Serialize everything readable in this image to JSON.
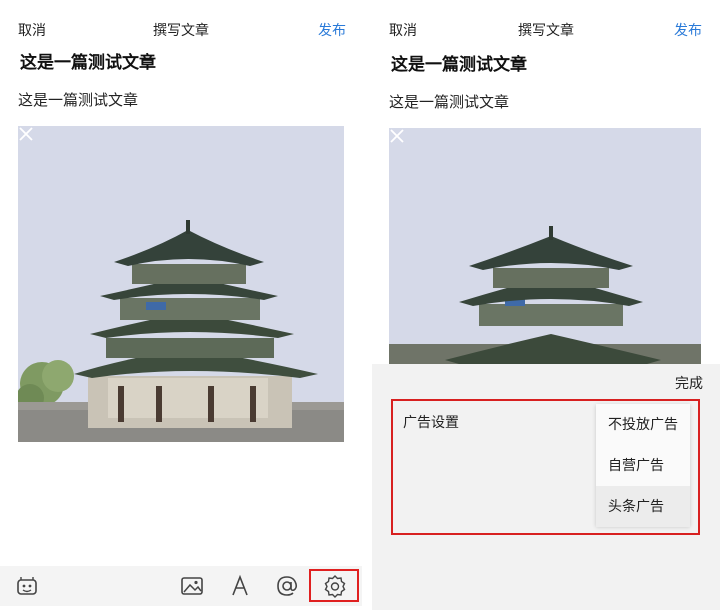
{
  "left": {
    "nav": {
      "cancel": "取消",
      "title": "撰写文章",
      "publish": "发布"
    },
    "article": {
      "title": "这是一篇测试文章",
      "body": "这是一篇测试文章"
    },
    "toolbar": {
      "icons": [
        "emoji-icon",
        "image-icon",
        "font-icon",
        "at-icon",
        "gear-icon"
      ]
    }
  },
  "right": {
    "nav": {
      "cancel": "取消",
      "title": "撰写文章",
      "publish": "发布"
    },
    "article": {
      "title": "这是一篇测试文章",
      "body": "这是一篇测试文章"
    },
    "sheet": {
      "done": "完成",
      "ad_label": "广告设置",
      "options": [
        "不投放广告",
        "自营广告",
        "头条广告"
      ],
      "selected": "头条广告"
    }
  },
  "colors": {
    "accent": "#2a7ad8",
    "highlight": "#e02020"
  }
}
